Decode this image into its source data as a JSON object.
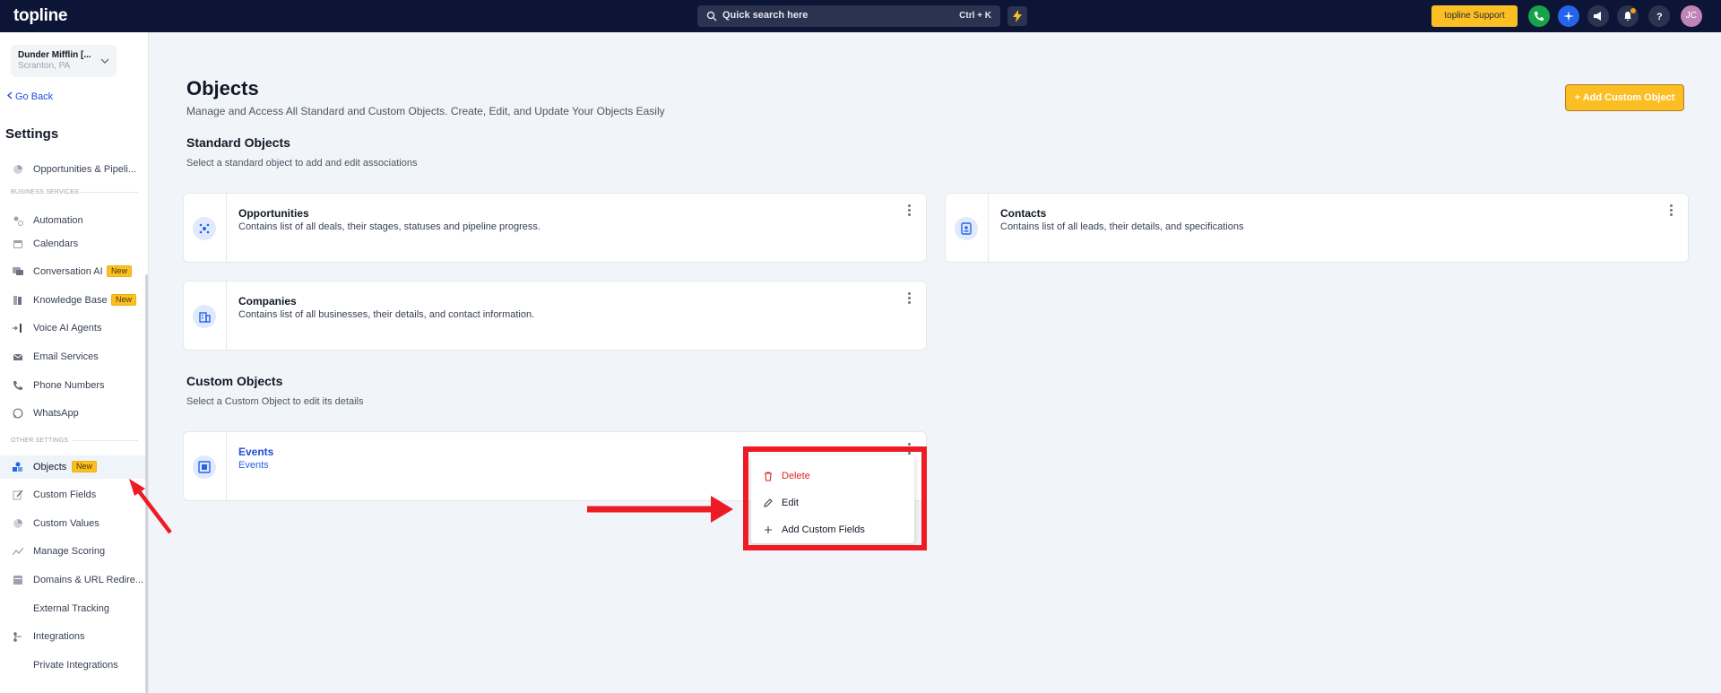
{
  "topbar": {
    "logo": "topline",
    "search_placeholder": "Quick search here",
    "search_shortcut": "Ctrl + K",
    "support_label": "topline Support",
    "avatar_initials": "JC"
  },
  "account": {
    "name": "Dunder Mifflin [...",
    "location": "Scranton, PA"
  },
  "sidebar": {
    "go_back": "Go Back",
    "title": "Settings",
    "items": [
      {
        "label": "Opportunities & Pipeli..."
      },
      {
        "label": "Automation"
      },
      {
        "label": "Calendars"
      },
      {
        "label": "Conversation AI",
        "badge": "New"
      },
      {
        "label": "Knowledge Base",
        "badge": "New"
      },
      {
        "label": "Voice AI Agents"
      },
      {
        "label": "Email Services"
      },
      {
        "label": "Phone Numbers"
      },
      {
        "label": "WhatsApp"
      },
      {
        "label": "Objects",
        "badge": "New"
      },
      {
        "label": "Custom Fields"
      },
      {
        "label": "Custom Values"
      },
      {
        "label": "Manage Scoring"
      },
      {
        "label": "Domains & URL Redire..."
      },
      {
        "label": "External Tracking"
      },
      {
        "label": "Integrations"
      },
      {
        "label": "Private Integrations"
      }
    ],
    "sections": {
      "business": "BUSINESS SERVICES",
      "other": "OTHER SETTINGS"
    }
  },
  "main": {
    "title": "Objects",
    "subtitle": "Manage and Access All Standard and Custom Objects. Create, Edit, and Update Your Objects Easily",
    "add_button": "+  Add Custom Object",
    "standard": {
      "title": "Standard Objects",
      "subtitle": "Select a standard object to add and edit associations",
      "cards": [
        {
          "title": "Opportunities",
          "desc": "Contains list of all deals, their stages, statuses and pipeline progress."
        },
        {
          "title": "Contacts",
          "desc": "Contains list of all leads, their details, and specifications"
        },
        {
          "title": "Companies",
          "desc": "Contains list of all businesses, their details, and contact information."
        }
      ]
    },
    "custom": {
      "title": "Custom Objects",
      "subtitle": "Select a Custom Object to edit its details",
      "cards": [
        {
          "title": "Events",
          "desc": "Events"
        }
      ]
    }
  },
  "menu": {
    "delete": "Delete",
    "edit": "Edit",
    "add_fields": "Add Custom Fields"
  },
  "colors": {
    "accent": "#fbbf24",
    "topbar": "#0c1536",
    "annotation": "#ed1c24"
  }
}
